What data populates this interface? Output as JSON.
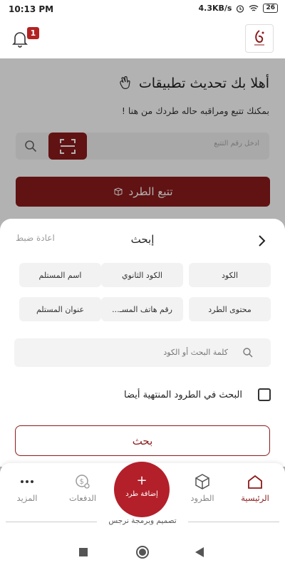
{
  "status_bar": {
    "time": "10:13 PM",
    "speed": "4.3KB/s",
    "battery": "26"
  },
  "header": {
    "notification_count": "1"
  },
  "home": {
    "welcome": "أهلا بك تحديث تطبيقات",
    "subtitle": "بمكنك تتبع ومراقبه حاله طردك من هنا !",
    "track_placeholder": "ادخل رقم التتبع",
    "track_button": "تتبع الطرد"
  },
  "search_sheet": {
    "title": "إبحث",
    "reset": "اعادة ضبط",
    "filters": [
      "الكود",
      "الكود الثانوي",
      "اسم المستلم",
      "محتوى الطرد",
      "رقم هاتف المسـ...",
      "عنوان المستلم"
    ],
    "keyword_placeholder": "كلمة البحث أو الكود",
    "include_finished": "البحث في الطرود المنتهية أيضا",
    "search_button": "بحث"
  },
  "bottom_nav": {
    "home": "الرئيسية",
    "parcels": "الطرود",
    "add_parcel": "إضافة طرد",
    "payments": "الدفعات",
    "more": "المزيد"
  },
  "credit": "تصميم وبرمجة نرجس",
  "colors": {
    "accent": "#8b1a1a",
    "fab": "#b3202a"
  }
}
